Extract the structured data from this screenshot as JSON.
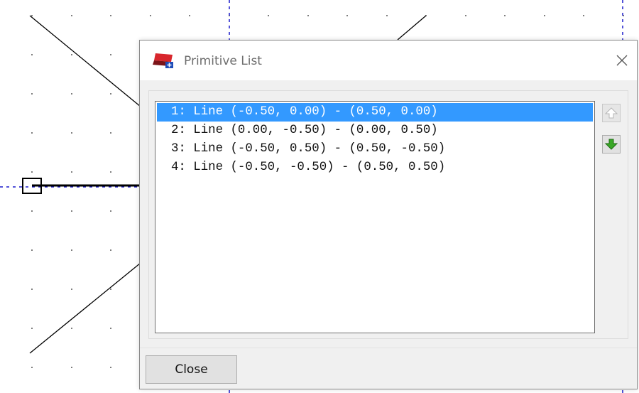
{
  "dialog": {
    "title": "Primitive List",
    "close_label": "Close",
    "items": [
      "1: Line (-0.50, 0.00) - (0.50, 0.00)",
      "2: Line (0.00, -0.50) - (0.00, 0.50)",
      "3: Line (-0.50, 0.50) - (0.50, -0.50)",
      "4: Line (-0.50, -0.50) - (0.50, 0.50)"
    ],
    "selected_index": 0
  },
  "icons": {
    "app": "primitive-editor-icon",
    "close": "close-icon",
    "up": "arrow-up-icon",
    "down": "arrow-down-icon"
  },
  "colors": {
    "selection": "#3399ff",
    "axis": "#1a1acc",
    "arrow_green": "#2f9e1f"
  }
}
